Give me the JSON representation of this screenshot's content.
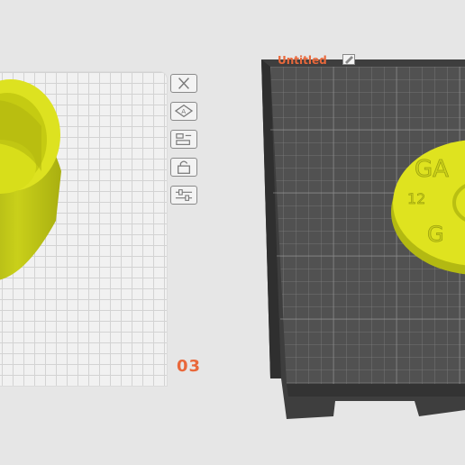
{
  "workplane_left": {
    "page_number": "03"
  },
  "workplane_right": {
    "title": "Untitled",
    "rename_icon": "pencil-icon"
  },
  "toolbar": {
    "items": [
      {
        "name": "delete-icon"
      },
      {
        "name": "scale-icon"
      },
      {
        "name": "align-icon"
      },
      {
        "name": "lock-icon"
      },
      {
        "name": "settings-sliders-icon"
      }
    ]
  },
  "model_text": {
    "line1": "GA",
    "line2": "12",
    "line3": "G"
  },
  "colors": {
    "accent": "#e9683b",
    "model_yellow": "#d6de1f",
    "plate_dark": "#4c4c4c"
  }
}
